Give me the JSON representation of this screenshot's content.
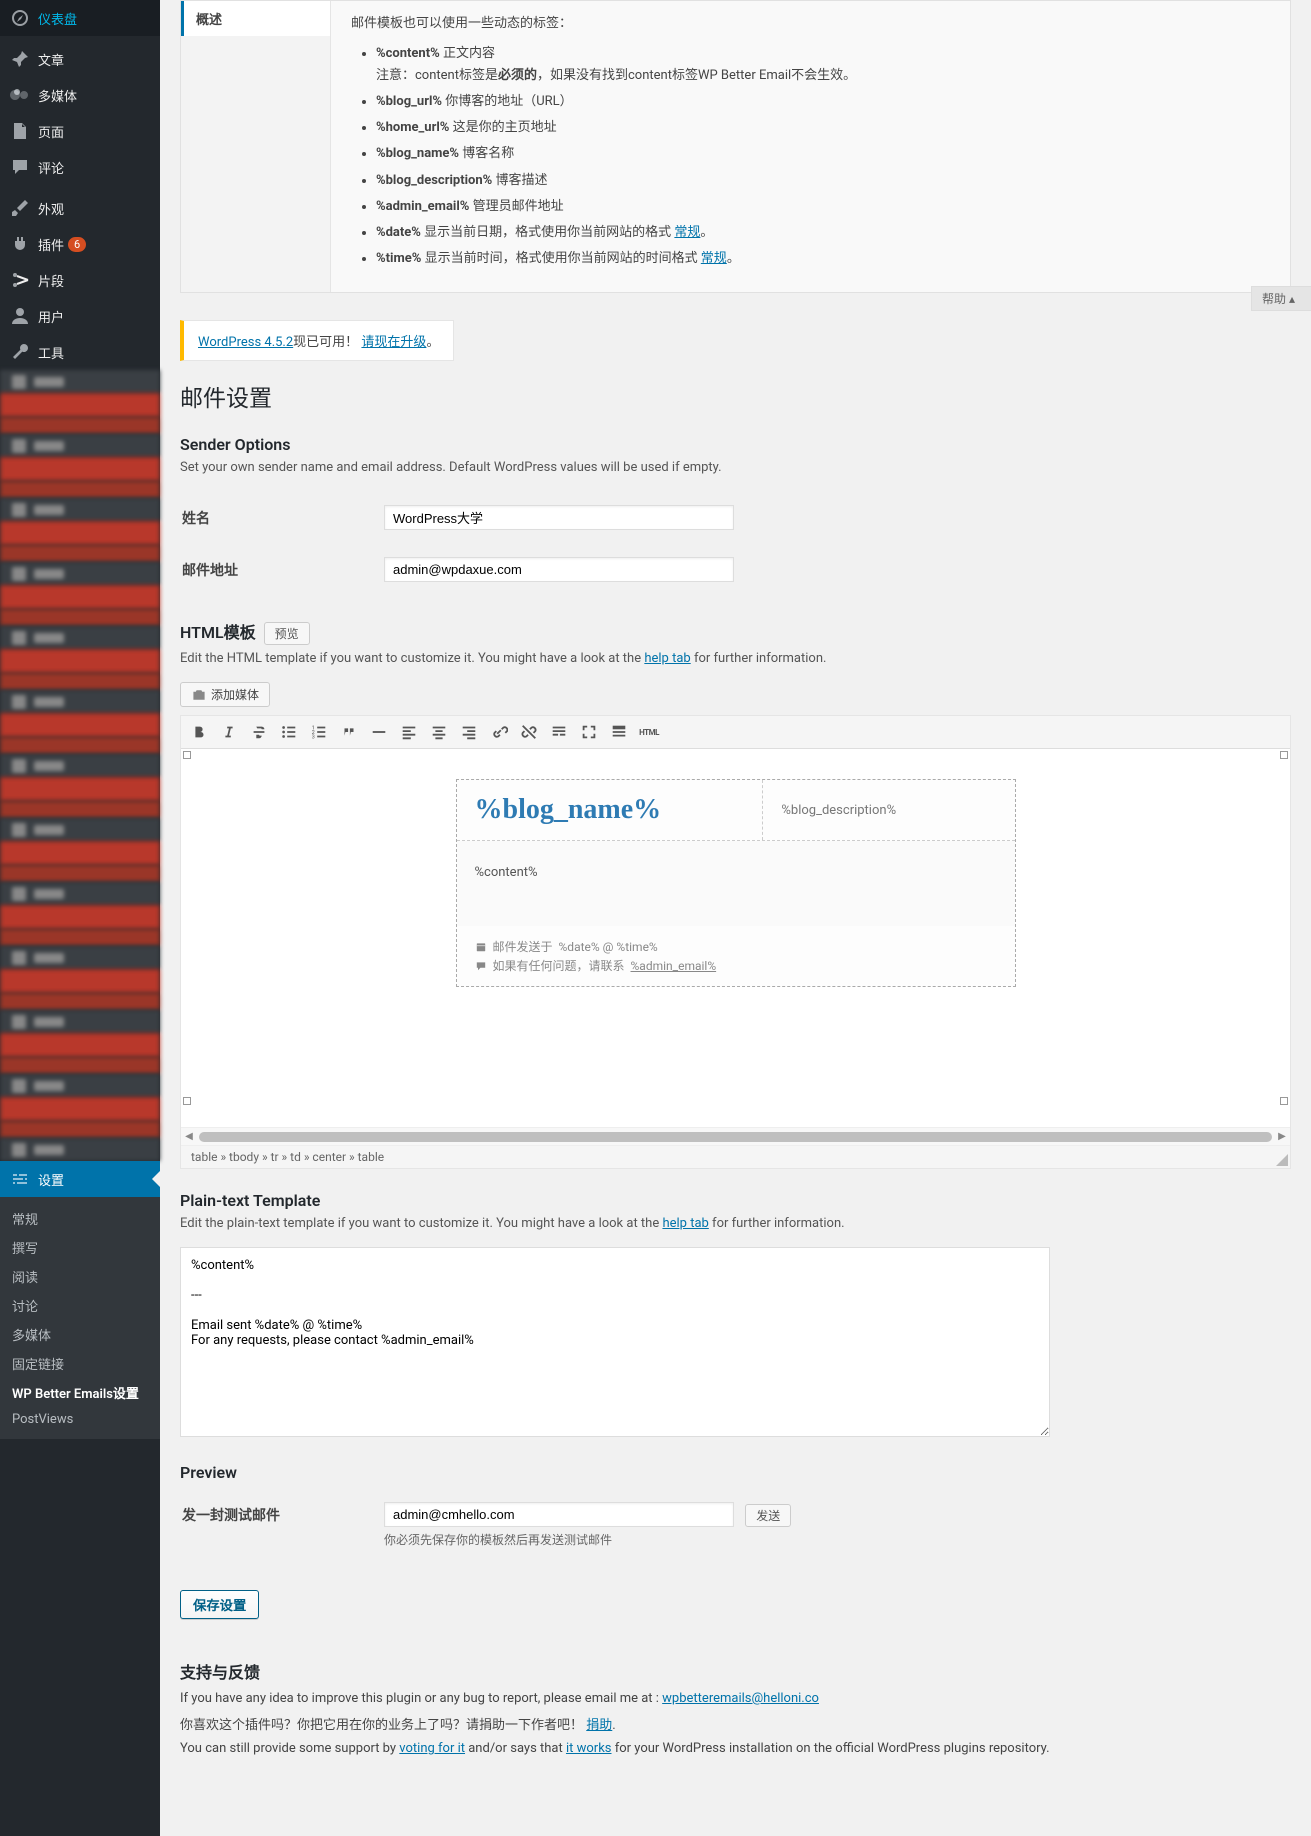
{
  "sidebar": {
    "items": [
      {
        "icon": "dashboard",
        "label": "仪表盘"
      },
      {
        "icon": "pin",
        "label": "文章"
      },
      {
        "icon": "media",
        "label": "多媒体"
      },
      {
        "icon": "page",
        "label": "页面"
      },
      {
        "icon": "comment",
        "label": "评论"
      },
      {
        "icon": "appearance",
        "label": "外观"
      },
      {
        "icon": "plugin",
        "label": "插件",
        "badge": "6"
      },
      {
        "icon": "snippet",
        "label": "片段"
      },
      {
        "icon": "user",
        "label": "用户"
      },
      {
        "icon": "tools",
        "label": "工具"
      }
    ],
    "settings_label": "设置",
    "submenu": [
      "常规",
      "撰写",
      "阅读",
      "讨论",
      "多媒体",
      "固定链接",
      "WP Better Emails设置",
      "PostViews"
    ]
  },
  "help_btn": "帮助",
  "help_panel": {
    "tab": "概述",
    "intro": "邮件模板也可以使用一些动态的标签：",
    "tags": [
      {
        "tag": "%content%",
        "desc": "正文内容",
        "note_pre": "注意：content标签是",
        "note_b": "必须的",
        "note_post": "，如果没有找到content标签WP Better Email不会生效。"
      },
      {
        "tag": "%blog_url%",
        "desc": "你博客的地址（URL）"
      },
      {
        "tag": "%home_url%",
        "desc": "这是你的主页地址"
      },
      {
        "tag": "%blog_name%",
        "desc": "博客名称"
      },
      {
        "tag": "%blog_description%",
        "desc": "博客描述"
      },
      {
        "tag": "%admin_email%",
        "desc": "管理员邮件地址"
      },
      {
        "tag": "%date%",
        "desc": "显示当前日期，格式使用你当前网站的格式",
        "link": "常规",
        "suffix": "。"
      },
      {
        "tag": "%time%",
        "desc": "显示当前时间，格式使用你当前网站的时间格式",
        "link": "常规",
        "suffix": "。"
      }
    ]
  },
  "update_nag": {
    "wp": "WordPress 4.5.2",
    "avail": "现已可用！",
    "upgrade": "请现在升级",
    "suffix": "。"
  },
  "page_title": "邮件设置",
  "sender": {
    "heading": "Sender Options",
    "desc": "Set your own sender name and email address. Default WordPress values will be used if empty.",
    "name_label": "姓名",
    "name_value": "WordPress大学",
    "email_label": "邮件地址",
    "email_value": "admin@wpdaxue.com"
  },
  "html_tpl": {
    "heading": "HTML模板",
    "preview_btn": "预览",
    "desc_pre": "Edit the HTML template if you want to customize it. You might have a look at the ",
    "help_link": "help tab",
    "desc_post": " for further information.",
    "add_media": "添加媒体",
    "html_btn": "HTML",
    "preview": {
      "blog_name": "%blog_name%",
      "blog_desc": "%blog_description%",
      "content": "%content%",
      "footer1_pre": "邮件发送于 ",
      "footer1_time": "%date% @ %time%",
      "footer2_pre": "如果有任何问题，请联系",
      "footer2_link": "%admin_email%"
    },
    "path": "table » tbody » tr » td » center » table"
  },
  "plain_tpl": {
    "heading": "Plain-text Template",
    "desc_pre": "Edit the plain-text template if you want to customize it. You might have a look at the ",
    "help_link": "help tab",
    "desc_post": " for further information.",
    "value": "%content%\n\n---\n\nEmail sent %date% @ %time%\nFor any requests, please contact %admin_email%"
  },
  "preview": {
    "heading": "Preview",
    "test_label": "发一封测试邮件",
    "test_value": "admin@cmhello.com",
    "send_btn": "发送",
    "note": "你必须先保存你的模板然后再发送测试邮件"
  },
  "save_btn": "保存设置",
  "feedback": {
    "heading": "支持与反馈",
    "l1_pre": "If you have any idea to improve this plugin or any bug to report, please email me at : ",
    "l1_link": "wpbetteremails@helloni.co",
    "l2_pre": "你喜欢这个插件吗？你把它用在你的业务上了吗？请捐助一下作者吧！",
    "l2_link": "捐助",
    "l2_post": ".",
    "l3_pre": "You can still provide some support by ",
    "l3_link1": "voting for it",
    "l3_mid": " and/or says that ",
    "l3_link2": "it works",
    "l3_post": " for your WordPress installation on the official WordPress plugins repository."
  }
}
